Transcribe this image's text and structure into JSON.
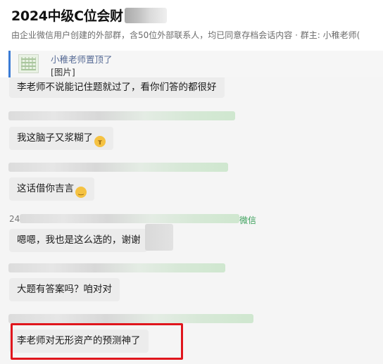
{
  "chat": {
    "title": "2024中级C位会财",
    "subtitle": "由企业微信用户创建的外部群，含50位外部联系人，均已同意存档会话内容 · 群主: 小稚老师(",
    "pinned": {
      "line1": "小稚老师置顶了",
      "line2": "[图片]"
    }
  },
  "messages": [
    {
      "text": "李老师不说能记住题就过了，看你们答的都很好"
    },
    {
      "text": "我这脑子又浆糊了",
      "emoji": "crying-face-icon"
    },
    {
      "text": "这话借你吉言",
      "emoji": "smiling-face-icon"
    },
    {
      "text": "嗯嗯，我也是这么选的，谢谢"
    },
    {
      "text": "大题有答案吗？咱对对"
    },
    {
      "text": "李老师对无形资产的预测神了"
    }
  ],
  "sender_fragments": {
    "number_prefix": "24",
    "wechat_tag": "微信"
  },
  "colors": {
    "highlight_border": "#e0161d",
    "pin_accent": "#3b7cd6",
    "bubble_bg": "#ececec"
  }
}
